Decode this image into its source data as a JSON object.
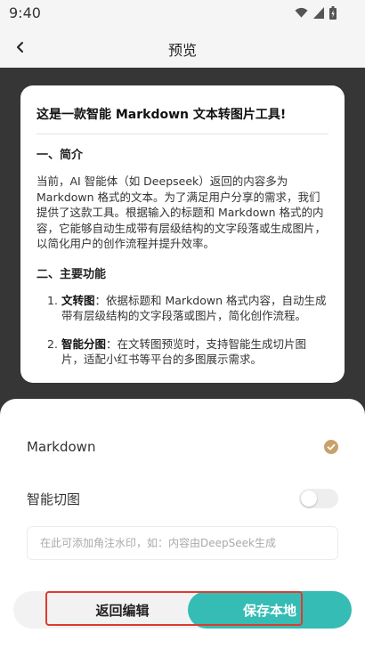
{
  "status_bar": {
    "time": "9:40",
    "icons": [
      "wifi-icon",
      "signal-icon",
      "battery-icon"
    ]
  },
  "app_bar": {
    "title": "预览",
    "back_icon": "chevron-left-icon"
  },
  "preview": {
    "title": "这是一款智能 Markdown 文本转图片工具!",
    "section1_heading": "一、简介",
    "intro": "当前，AI 智能体（如 Deepseek）返回的内容多为 Markdown 格式的文本。为了满足用户分享的需求，我们提供了这款工具。根据输入的标题和 Markdown 格式的内容，它能够自动生成带有层级结构的文字段落或生成图片，以简化用户的创作流程并提升效率。",
    "section2_heading": "二、主要功能",
    "features": [
      {
        "num": "1.",
        "name": "文转图",
        "desc": "：依据标题和 Markdown 格式内容，自动生成带有层级结构的文字段落或图片，简化创作流程。"
      },
      {
        "num": "2.",
        "name": "智能分图",
        "desc": "：在文转图预览时，支持智能生成切片图片，适配小红书等平台的多图展示需求。"
      }
    ]
  },
  "options": {
    "markdown_label": "Markdown",
    "markdown_selected": true,
    "smart_split_label": "智能切图",
    "smart_split_on": false,
    "watermark_placeholder": "在此可添加角注水印，如：内容由DeepSeek生成",
    "watermark_value": ""
  },
  "actions": {
    "back_label": "返回编辑",
    "save_label": "保存本地"
  },
  "colors": {
    "accent": "#35bcb4",
    "check": "#c7a26b",
    "highlight": "#e03a2f",
    "preview_bg": "#363636"
  }
}
